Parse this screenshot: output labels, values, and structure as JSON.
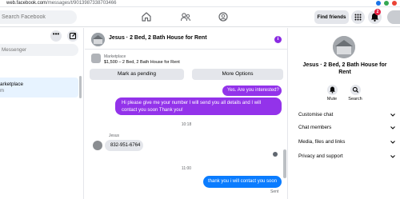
{
  "browser": {
    "url_host": "web.facebook.com",
    "url_path": "/messages/t/9013987338703466"
  },
  "topbar": {
    "search_placeholder": "Search Facebook",
    "find_friends": "Find friends",
    "notif_count": "2"
  },
  "left": {
    "title": "",
    "dots": "•••",
    "search_placeholder": "Messenger",
    "conversation": {
      "line1": "arketplace",
      "line2": "m"
    }
  },
  "chat": {
    "title": "Jesus · 2 Bed, 2 Bath House for Rent",
    "info_icon": "i",
    "listing": {
      "source": "Marketplace",
      "desc": "$1,500 – 2 Bed, 2 Bath House for Rent"
    },
    "mark_pending": "Mark as pending",
    "more_options": "More Options",
    "messages": {
      "m1": "Yes. Are you interested?",
      "m2": "Hi please give me your number I will send you all details and I will contact you soon Thank you!",
      "time1": "10:18",
      "sender": "Jesus",
      "m3": "832-951-6764",
      "time2": "11:00",
      "m4": "thank you i will contact you soon",
      "sent": "Sent"
    }
  },
  "right": {
    "title": "Jesus · 2 Bed, 2 Bath House for Rent",
    "mute": "Mute",
    "search": "Search",
    "rows": [
      "Customise chat",
      "Chat members",
      "Media, files and links",
      "Privacy and support"
    ]
  },
  "colors": {
    "accent": "#9333ea",
    "blue": "#0a7cff",
    "badge": "#e41e3f"
  }
}
